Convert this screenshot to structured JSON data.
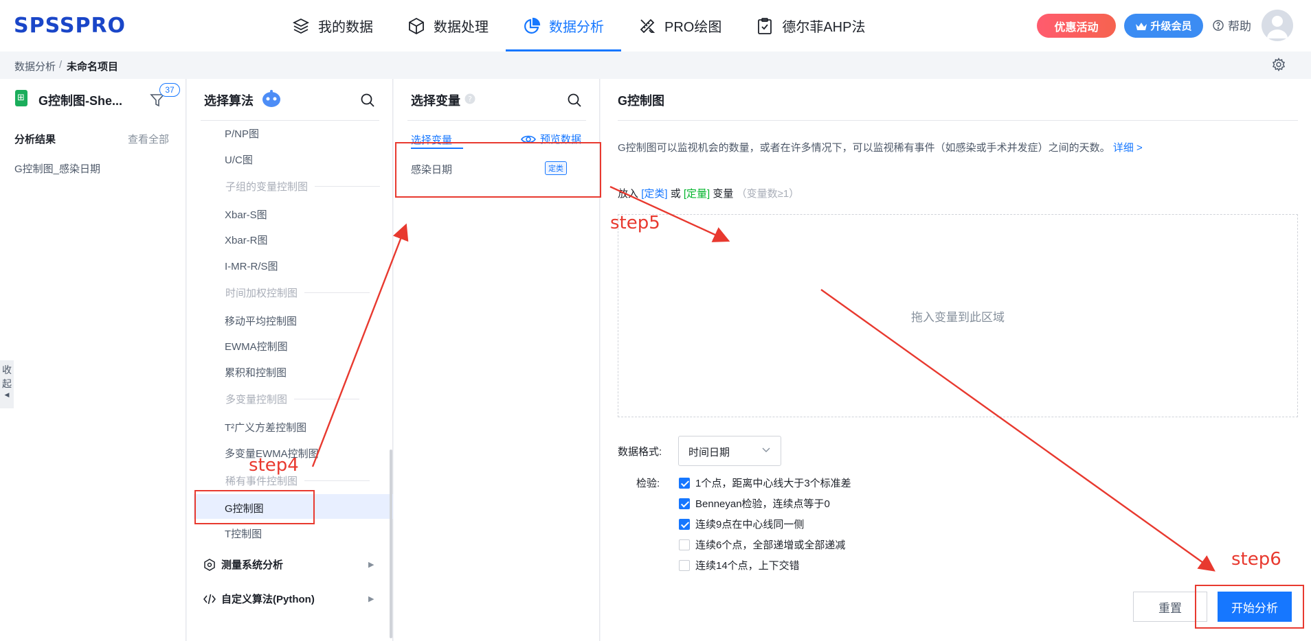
{
  "app": {
    "logo": "SPSSPRO"
  },
  "nav": [
    {
      "label": "我的数据",
      "icon": "layers-icon"
    },
    {
      "label": "数据处理",
      "icon": "cube-icon"
    },
    {
      "label": "数据分析",
      "icon": "pie-chart-icon",
      "active": true
    },
    {
      "label": "PRO绘图",
      "icon": "ruler-pencil-icon"
    },
    {
      "label": "德尔菲AHP法",
      "icon": "clipboard-check-icon"
    }
  ],
  "header": {
    "promo": "优惠活动",
    "upgrade": "升级会员",
    "help": "帮助"
  },
  "breadcrumb": {
    "root": "数据分析",
    "sep": "/",
    "current": "未命名项目"
  },
  "sheet": {
    "title": "G控制图-She...",
    "filter_count": "37"
  },
  "results": {
    "title": "分析结果",
    "view_all": "查看全部",
    "items": [
      "G控制图_感染日期"
    ]
  },
  "collapse_label": "收起",
  "algorithms": {
    "title": "选择算法",
    "items": [
      {
        "label": "P/NP图",
        "kind": "item"
      },
      {
        "label": "U/C图",
        "kind": "item"
      },
      {
        "label": "子组的变量控制图",
        "kind": "group"
      },
      {
        "label": "Xbar-S图",
        "kind": "item"
      },
      {
        "label": "Xbar-R图",
        "kind": "item"
      },
      {
        "label": "I-MR-R/S图",
        "kind": "item"
      },
      {
        "label": "时间加权控制图",
        "kind": "group"
      },
      {
        "label": "移动平均控制图",
        "kind": "item"
      },
      {
        "label": "EWMA控制图",
        "kind": "item"
      },
      {
        "label": "累积和控制图",
        "kind": "item"
      },
      {
        "label": "多变量控制图",
        "kind": "group"
      },
      {
        "label": "T²广义方差控制图",
        "kind": "item"
      },
      {
        "label": "多变量EWMA控制图",
        "kind": "item"
      },
      {
        "label": "稀有事件控制图",
        "kind": "group"
      },
      {
        "label": "G控制图",
        "kind": "item",
        "selected": true
      },
      {
        "label": "T控制图",
        "kind": "item"
      }
    ],
    "categories": [
      {
        "label": "测量系统分析",
        "icon": "hexagon-icon"
      },
      {
        "label": "自定义算法(Python)",
        "icon": "code-icon"
      }
    ]
  },
  "variables": {
    "title": "选择变量",
    "tab": "选择变量",
    "preview": "预览数据",
    "items": [
      {
        "label": "感染日期",
        "tag": "定类"
      }
    ]
  },
  "config": {
    "title": "G控制图",
    "description": "G控制图可以监视机会的数量，或者在许多情况下，可以监视稀有事件（如感染或手术并发症）之间的天数。",
    "detail_link": "详细 >",
    "drop_prefix": "放入",
    "tag_categorical": "[定类]",
    "or": "或",
    "tag_quantitative": "[定量]",
    "drop_suffix": "变量",
    "drop_hint": "（变量数≥1）",
    "drop_zone": "拖入变量到此区域",
    "format_label": "数据格式:",
    "format_value": "时间日期",
    "checks_label": "检验:",
    "checks": [
      {
        "label": "1个点，距离中心线大于3个标准差",
        "checked": true
      },
      {
        "label": "Benneyan检验，连续点等于0",
        "checked": true
      },
      {
        "label": "连续9点在中心线同一侧",
        "checked": true
      },
      {
        "label": "连续6个点，全部递增或全部递减",
        "checked": false
      },
      {
        "label": "连续14个点，上下交错",
        "checked": false
      }
    ],
    "reset": "重置",
    "start": "开始分析"
  },
  "annotations": {
    "step4": "step4",
    "step5": "step5",
    "step6": "step6",
    "color": "#e8392f"
  },
  "colors": {
    "accent": "#1677ff",
    "promo": "#ff5b6e",
    "upgrade": "#3b8cf3"
  }
}
